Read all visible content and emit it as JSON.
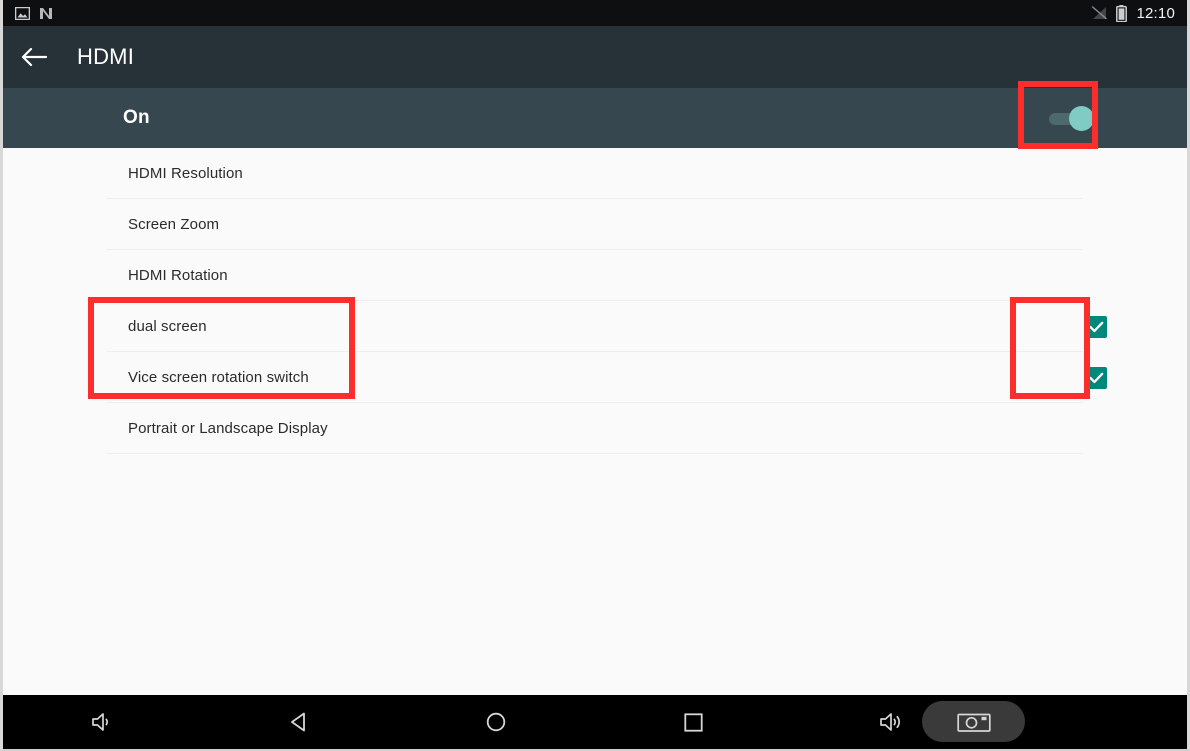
{
  "status_bar": {
    "left_icons": [
      "screenshot-image-icon",
      "nfc-n-icon"
    ],
    "right_icons": [
      "signal-off-icon",
      "battery-icon"
    ],
    "time": "12:10"
  },
  "app_bar": {
    "back_icon": "back-arrow-icon",
    "title": "HDMI"
  },
  "master": {
    "label": "On",
    "switch_state": "on",
    "switch_icon": "toggle-switch-on-icon",
    "accent_color": "#80cbc4",
    "row_background": "#37474f"
  },
  "list": {
    "rows": [
      {
        "label": "HDMI Resolution",
        "control": "none",
        "highlighted": false
      },
      {
        "label": "Screen Zoom",
        "control": "none",
        "highlighted": false
      },
      {
        "label": "HDMI Rotation",
        "control": "none",
        "highlighted": false
      },
      {
        "label": "dual screen",
        "control": "checkbox",
        "checked": true,
        "highlighted": true
      },
      {
        "label": "Vice screen rotation switch",
        "control": "checkbox",
        "checked": true,
        "highlighted": true
      },
      {
        "label": "Portrait or Landscape Display",
        "control": "none",
        "highlighted": false
      }
    ],
    "checkbox_color": "#00897b"
  },
  "annotations": {
    "color": "#fb2d2d",
    "boxes": [
      {
        "name": "switch-highlight",
        "target": "master-switch"
      },
      {
        "name": "labels-highlight",
        "target": "dual-screen-and-vice-screen-rows"
      },
      {
        "name": "checkboxes-highlight",
        "target": "dual-screen-and-vice-screen-checkboxes"
      }
    ]
  },
  "nav_bar": {
    "buttons": [
      {
        "name": "volume-down-icon",
        "label": "volume down"
      },
      {
        "name": "back-triangle-icon",
        "label": "back"
      },
      {
        "name": "home-circle-icon",
        "label": "home"
      },
      {
        "name": "recents-square-icon",
        "label": "recent apps"
      },
      {
        "name": "volume-up-icon",
        "label": "volume up"
      },
      {
        "name": "screenshot-camera-icon",
        "label": "screenshot"
      }
    ]
  }
}
